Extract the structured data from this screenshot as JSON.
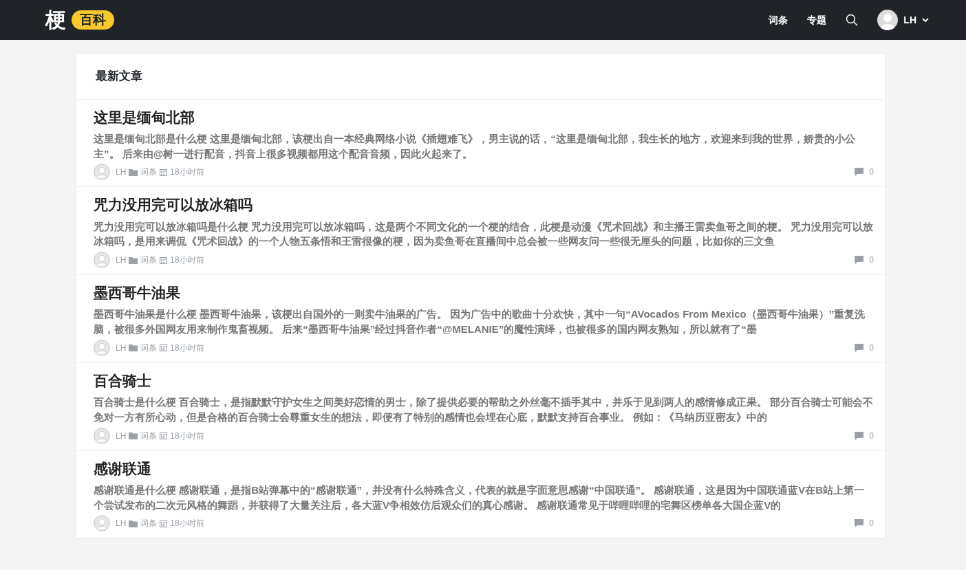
{
  "header": {
    "logo_char": "梗",
    "logo_badge": "百科",
    "nav": [
      {
        "label": "词条"
      },
      {
        "label": "专题"
      }
    ],
    "user": {
      "name": "LH"
    }
  },
  "section_title": "最新文章",
  "articles": [
    {
      "title": "这里是缅甸北部",
      "excerpt": "这里是缅甸北部是什么梗 这里是缅甸北部，该梗出自一本经典网络小说《插翅难飞》，男主说的话，“这里是缅甸北部，我生长的地方，欢迎来到我的世界，娇贵的小公主”。 后来由@树一进行配音，抖音上很多视频都用这个配音音频，因此火起来了。",
      "author": "LH",
      "category": "词条",
      "time": "18小时前",
      "comments": "0"
    },
    {
      "title": "咒力没用完可以放冰箱吗",
      "excerpt": "咒力没用完可以放冰箱吗是什么梗 咒力没用完可以放冰箱吗，这是两个不同文化的一个梗的结合，此梗是动漫《咒术回战》和主播王雷卖鱼哥之间的梗。 咒力没用完可以放冰箱吗，是用来调侃《咒术回战》的一个人物五条悟和王雷很像的梗，因为卖鱼哥在直播间中总会被一些网友问一些很无厘头的问题，比如你的三文鱼",
      "author": "LH",
      "category": "词条",
      "time": "18小时前",
      "comments": "0"
    },
    {
      "title": "墨西哥牛油果",
      "excerpt": "墨西哥牛油果是什么梗 墨西哥牛油果，该梗出自国外的一则卖牛油果的广告。 因为广告中的歌曲十分欢快，其中一句“AVocados From Mexico（墨西哥牛油果）”重复洗脑，被很多外国网友用来制作鬼畜视频。 后来“墨西哥牛油果”经过抖音作者“@MELANIE”的魔性演绎，也被很多的国内网友熟知，所以就有了“墨",
      "author": "LH",
      "category": "词条",
      "time": "18小时前",
      "comments": "0"
    },
    {
      "title": "百合骑士",
      "excerpt": "百合骑士是什么梗 百合骑士，是指默默守护女生之间美好恋情的男士，除了提供必要的帮助之外丝毫不插手其中，并乐于见到两人的感情修成正果。 部分百合骑士可能会不免对一方有所心动，但是合格的百合骑士会尊重女生的想法，即便有了特别的感情也会埋在心底，默默支持百合事业。 例如：《马纳历亚密友》中的",
      "author": "LH",
      "category": "词条",
      "time": "18小时前",
      "comments": "0"
    },
    {
      "title": "感谢联通",
      "excerpt": "感谢联通是什么梗 感谢联通，是指B站弹幕中的“感谢联通”，并没有什么特殊含义，代表的就是字面意思感谢“中国联通”。 感谢联通，这是因为中国联通蓝V在B站上第一个尝试发布的二次元风格的舞蹈，并获得了大量关注后，各大蓝V争相效仿后观众们的真心感谢。 感谢联通常见于哔哩哔哩的宅舞区榜单各大国企蓝V的",
      "author": "LH",
      "category": "词条",
      "time": "18小时前",
      "comments": "0"
    }
  ]
}
